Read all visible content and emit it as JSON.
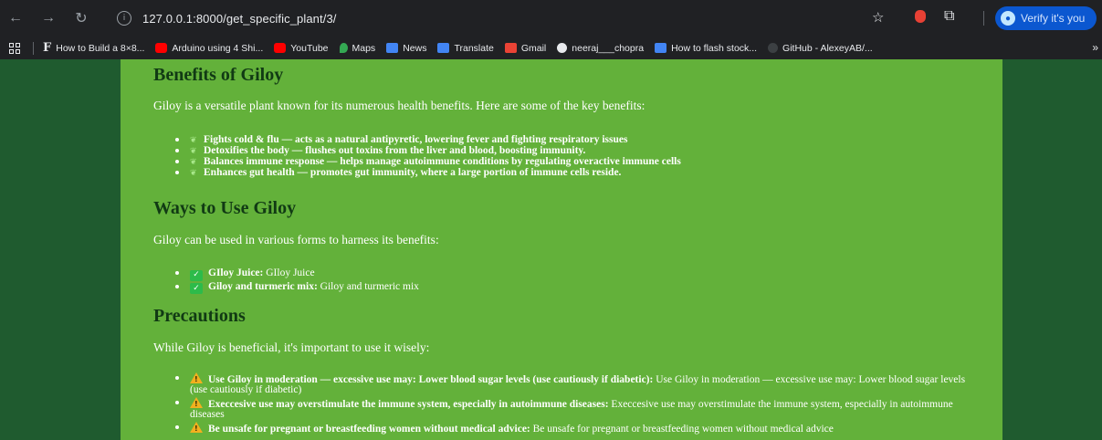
{
  "browser": {
    "url": "127.0.0.1:8000/get_specific_plant/3/",
    "verify_label": "Verify it's you",
    "bookmarks": [
      {
        "label": "How to Build a 8×8...",
        "icon": "f-favicon"
      },
      {
        "label": "Arduino using 4 Shi...",
        "icon": "youtube-icon"
      },
      {
        "label": "YouTube",
        "icon": "youtube-icon"
      },
      {
        "label": "Maps",
        "icon": "maps-icon"
      },
      {
        "label": "News",
        "icon": "news-icon"
      },
      {
        "label": "Translate",
        "icon": "translate-icon"
      },
      {
        "label": "Gmail",
        "icon": "gmail-icon"
      },
      {
        "label": "neeraj___chopra",
        "icon": "github-icon"
      },
      {
        "label": "How to flash stock...",
        "icon": "bookmark-icon"
      },
      {
        "label": "GitHub - AlexeyAB/...",
        "icon": "github-icon"
      }
    ]
  },
  "benefits": {
    "heading": "Benefits of Giloy",
    "intro": "Giloy is a versatile plant known for its numerous health benefits. Here are some of the key benefits:",
    "items": [
      "Fights cold & flu — acts as a natural antipyretic, lowering fever and fighting respiratory issues",
      "Detoxifies the body — flushes out toxins from the liver and blood, boosting immunity.",
      "Balances immune response — helps manage autoimmune conditions by regulating overactive immune cells",
      "Enhances gut health — promotes gut immunity, where a large portion of immune cells reside."
    ]
  },
  "uses": {
    "heading": "Ways to Use Giloy",
    "intro": "Giloy can be used in various forms to harness its benefits:",
    "items": [
      {
        "title": "GIloy Juice:",
        "desc": "GIloy Juice"
      },
      {
        "title": "Giloy and turmeric mix:",
        "desc": "Giloy and turmeric mix"
      }
    ]
  },
  "precautions": {
    "heading": "Precautions",
    "intro": "While Giloy is beneficial, it's important to use it wisely:",
    "items": [
      {
        "title": "Use Giloy in moderation — excessive use may: Lower blood sugar levels (use cautiously if diabetic):",
        "desc": "Use Giloy in moderation — excessive use may: Lower blood sugar levels (use cautiously if diabetic)"
      },
      {
        "title": "Execcesive use may overstimulate the immune system, especially in autoimmune diseases:",
        "desc": "Execcesive use may overstimulate the immune system, especially in autoimmune diseases"
      },
      {
        "title": "Be unsafe for pregnant or breastfeeding women without medical advice:",
        "desc": "Be unsafe for pregnant or breastfeeding women without medical advice"
      }
    ]
  }
}
